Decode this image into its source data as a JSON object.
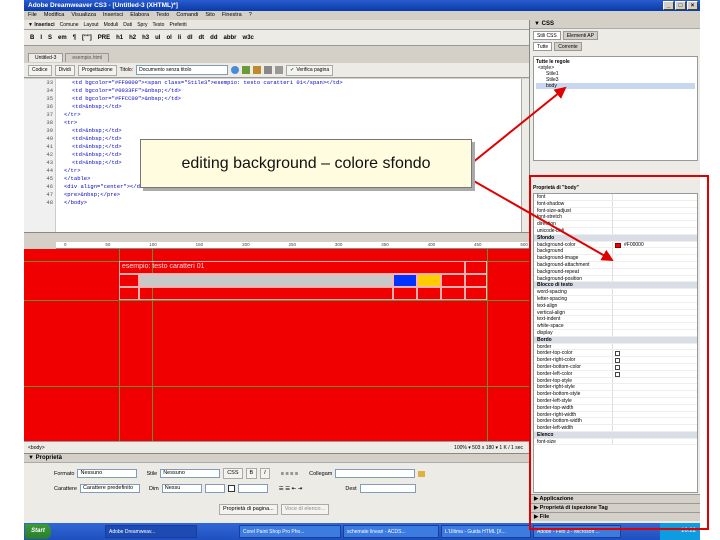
{
  "app": {
    "title": "Adobe Dreamweaver CS3 - [Untitled-3 (XHTML)*]",
    "menu": [
      "File",
      "Modifica",
      "Visualizza",
      "Inserisci",
      "Elabora",
      "Testo",
      "Comandi",
      "Sito",
      "Finestra",
      "?"
    ]
  },
  "insertbar": {
    "header": "▼ Inserisci",
    "tabs": [
      "Comune",
      "Layout",
      "Moduli",
      "Dati",
      "Spry",
      "Testo",
      "Preferiti"
    ]
  },
  "htmltoolbar": [
    "B",
    "I",
    "S",
    "em",
    "¶",
    "[\"\"]",
    "PRE",
    "h1",
    "h2",
    "h3",
    "ul",
    "ol",
    "li",
    "dl",
    "dt",
    "dd",
    "abbr",
    "w3c"
  ],
  "doctabs": [
    "Untitled-3",
    "esempio.html"
  ],
  "doctoolbar": {
    "code": "Codice",
    "split": "Dividi",
    "design": "Progettazione",
    "title_label": "Titolo:",
    "title_value": "Documento senza titolo",
    "verify": "Verifica pagina"
  },
  "code": {
    "line_numbers": [
      "33",
      "34",
      "35",
      "36",
      "37",
      "38",
      "39",
      "40",
      "41",
      "42",
      "43",
      "44",
      "45",
      "46",
      "47",
      "48"
    ],
    "lines": [
      "<td bgcolor=\"#FF0000\"><span class=\"Stile3\">esempio: testo caratteri 01</span></td>",
      "<td bgcolor=\"#0033FF\">&nbsp;</td>",
      "<td bgcolor=\"#FFCC00\">&nbsp;</td>",
      "<td>&nbsp;</td>",
      "</tr>",
      "<tr>",
      "<td>&nbsp;</td>",
      "<td>&nbsp;</td>",
      "<td>&nbsp;</td>",
      "<td>&nbsp;</td>",
      "<td>&nbsp;</td>",
      "</tr>",
      "</table>",
      "<div align=\"center\"></div>",
      "<pre>&nbsp;</pre>",
      "</body>"
    ]
  },
  "ruler": [
    "0",
    "50",
    "100",
    "150",
    "200",
    "250",
    "300",
    "350",
    "400",
    "450",
    "500"
  ],
  "design": {
    "bg_color": "#F00000",
    "caption": "esempio: testo caratteri 01",
    "cell_blue": "#0033FF",
    "cell_yellow": "#FFCC00"
  },
  "status": {
    "tag": "<body>",
    "info": "100% ▾  503 x 180 ▾  1 K / 1 sec"
  },
  "properties": {
    "title": "▼ Proprietà",
    "format_label": "Formato",
    "format_value": "Nessuno",
    "style_label": "Stile",
    "style_value": "Nessuno",
    "css_button": "CSS",
    "link_label": "Collegam",
    "font_label": "Carattere",
    "font_value": "Carattere predefinito",
    "size_label": "Dim",
    "size_value": "Nessu",
    "target_label": "Dest",
    "page_props": "Proprietà di pagina...",
    "list_item": "Voce di elenco..."
  },
  "css_panel": {
    "header": "▼ CSS",
    "tabs": [
      "Stili CSS",
      "Elementi AP"
    ],
    "subtabs": [
      "Tutte",
      "Corrente"
    ],
    "rules_header": "Tutte le regole",
    "rules": [
      "<style>",
      "Stile1",
      "Stile3",
      "body"
    ],
    "props_header": "Proprietà di \"body\"",
    "properties": [
      {
        "name": "font",
        "cat": false
      },
      {
        "name": "font-shadow",
        "cat": false
      },
      {
        "name": "font-size-adjust",
        "cat": false
      },
      {
        "name": "font-stretch",
        "cat": false
      },
      {
        "name": "direction",
        "cat": false
      },
      {
        "name": "unicode-bidi",
        "cat": false
      },
      {
        "name": "Sfondo",
        "cat": true
      },
      {
        "name": "background-color",
        "cat": false,
        "value": "#F00000"
      },
      {
        "name": "background",
        "cat": false
      },
      {
        "name": "background-image",
        "cat": false
      },
      {
        "name": "background-attachment",
        "cat": false
      },
      {
        "name": "background-repeat",
        "cat": false
      },
      {
        "name": "background-position",
        "cat": false
      },
      {
        "name": "Blocco di testo",
        "cat": true
      },
      {
        "name": "word-spacing",
        "cat": false
      },
      {
        "name": "letter-spacing",
        "cat": false
      },
      {
        "name": "text-align",
        "cat": false
      },
      {
        "name": "vertical-align",
        "cat": false
      },
      {
        "name": "text-indent",
        "cat": false
      },
      {
        "name": "white-space",
        "cat": false
      },
      {
        "name": "display",
        "cat": false
      },
      {
        "name": "Bordo",
        "cat": true
      },
      {
        "name": "border",
        "cat": false
      },
      {
        "name": "border-top-color",
        "cat": false,
        "chk": true
      },
      {
        "name": "border-right-color",
        "cat": false,
        "chk": true
      },
      {
        "name": "border-bottom-color",
        "cat": false,
        "chk": true
      },
      {
        "name": "border-left-color",
        "cat": false,
        "chk": true
      },
      {
        "name": "border-top-style",
        "cat": false
      },
      {
        "name": "border-right-style",
        "cat": false
      },
      {
        "name": "border-bottom-style",
        "cat": false
      },
      {
        "name": "border-left-style",
        "cat": false
      },
      {
        "name": "border-top-width",
        "cat": false
      },
      {
        "name": "border-right-width",
        "cat": false
      },
      {
        "name": "border-bottom-width",
        "cat": false
      },
      {
        "name": "border-left-width",
        "cat": false
      },
      {
        "name": "Elenco",
        "cat": true
      },
      {
        "name": "font-size",
        "cat": false
      }
    ],
    "panels": [
      "▶ Applicazione",
      "▶ Proprietà di ispezione Tag",
      "▶ File"
    ]
  },
  "annotation": "editing background – colore sfondo",
  "taskbar": {
    "start": "Start",
    "tasks": [
      "Adobe Dreamweav...",
      "Corel Paint Shop Pro Pho...",
      "schemate lineari - ACDS...",
      "L'Ultima - Guida HTML [X...",
      "Adobe - Flex 3 - Microsoft ..."
    ],
    "clock": "16.22"
  }
}
